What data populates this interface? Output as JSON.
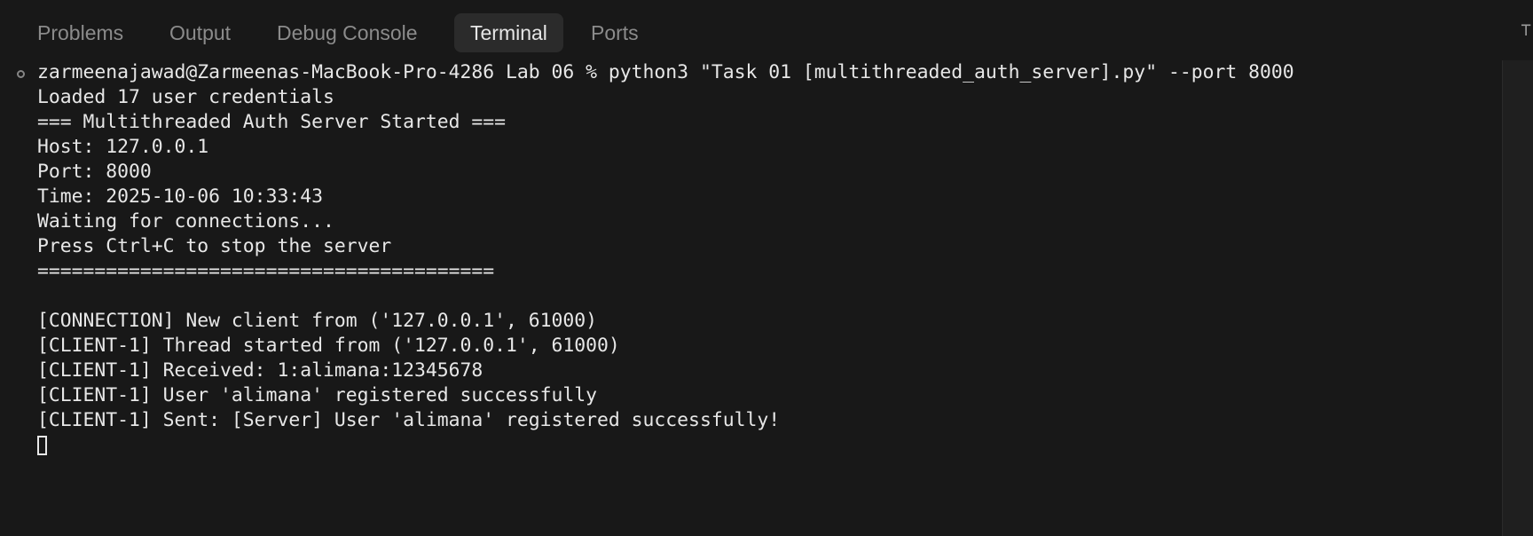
{
  "tabs": [
    {
      "label": "Problems",
      "active": false
    },
    {
      "label": "Output",
      "active": false
    },
    {
      "label": "Debug Console",
      "active": false
    },
    {
      "label": "Terminal",
      "active": true
    },
    {
      "label": "Ports",
      "active": false
    }
  ],
  "terminal": {
    "lines": [
      "zarmeenajawad@Zarmeenas-MacBook-Pro-4286 Lab 06 % python3 \"Task 01 [multithreaded_auth_server].py\" --port 8000",
      "Loaded 17 user credentials",
      "=== Multithreaded Auth Server Started ===",
      "Host: 127.0.0.1",
      "Port: 8000",
      "Time: 2025-10-06 10:33:43",
      "Waiting for connections...",
      "Press Ctrl+C to stop the server",
      "========================================",
      "",
      "[CONNECTION] New client from ('127.0.0.1', 61000)",
      "[CLIENT-1] Thread started from ('127.0.0.1', 61000)",
      "[CLIENT-1] Received: 1:alimana:12345678",
      "[CLIENT-1] User 'alimana' registered successfully",
      "[CLIENT-1] Sent: [Server] User 'alimana' registered successfully!"
    ]
  },
  "icons": {
    "status": "status-circle-icon",
    "overflow": "panel-overflow-icon"
  },
  "colors": {
    "panel_background": "#181818",
    "active_tab_background": "#2b2b2b",
    "text": "#e7e7e7",
    "muted_text": "#8b8b8b"
  }
}
